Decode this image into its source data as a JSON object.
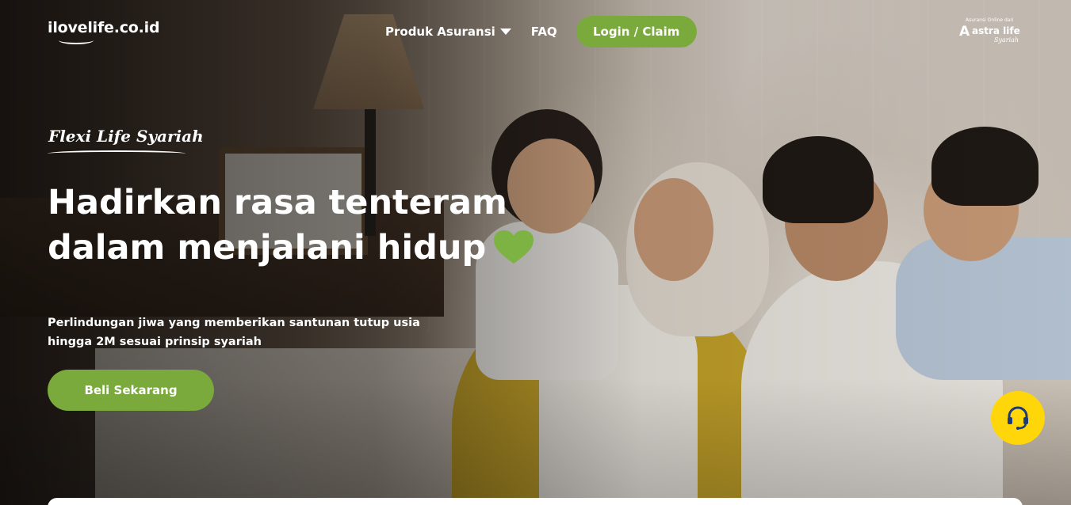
{
  "header": {
    "logo_text": "ilovelife.co.id",
    "nav": {
      "products_label": "Produk Asuransi",
      "faq_label": "FAQ",
      "login_label": "Login / Claim"
    },
    "partner": {
      "tagline": "Asuransi Online dari",
      "name": "astra life",
      "subname": "Syariah"
    }
  },
  "hero": {
    "product_name": "Flexi Life Syariah",
    "headline_line1": "Hadirkan rasa tenteram",
    "headline_line2": "dalam menjalani hidup",
    "subtext": "Perlindungan jiwa yang memberikan santunan tutup usia hingga 2M sesuai prinsip syariah",
    "cta_label": "Beli Sekarang"
  },
  "icons": {
    "heart": "heart-icon",
    "caret": "chevron-down-icon",
    "help": "headset-icon"
  },
  "colors": {
    "brand_green": "#7aa93c",
    "heart_green": "#7cb342",
    "help_yellow": "#ffd60a",
    "text_white": "#ffffff"
  }
}
